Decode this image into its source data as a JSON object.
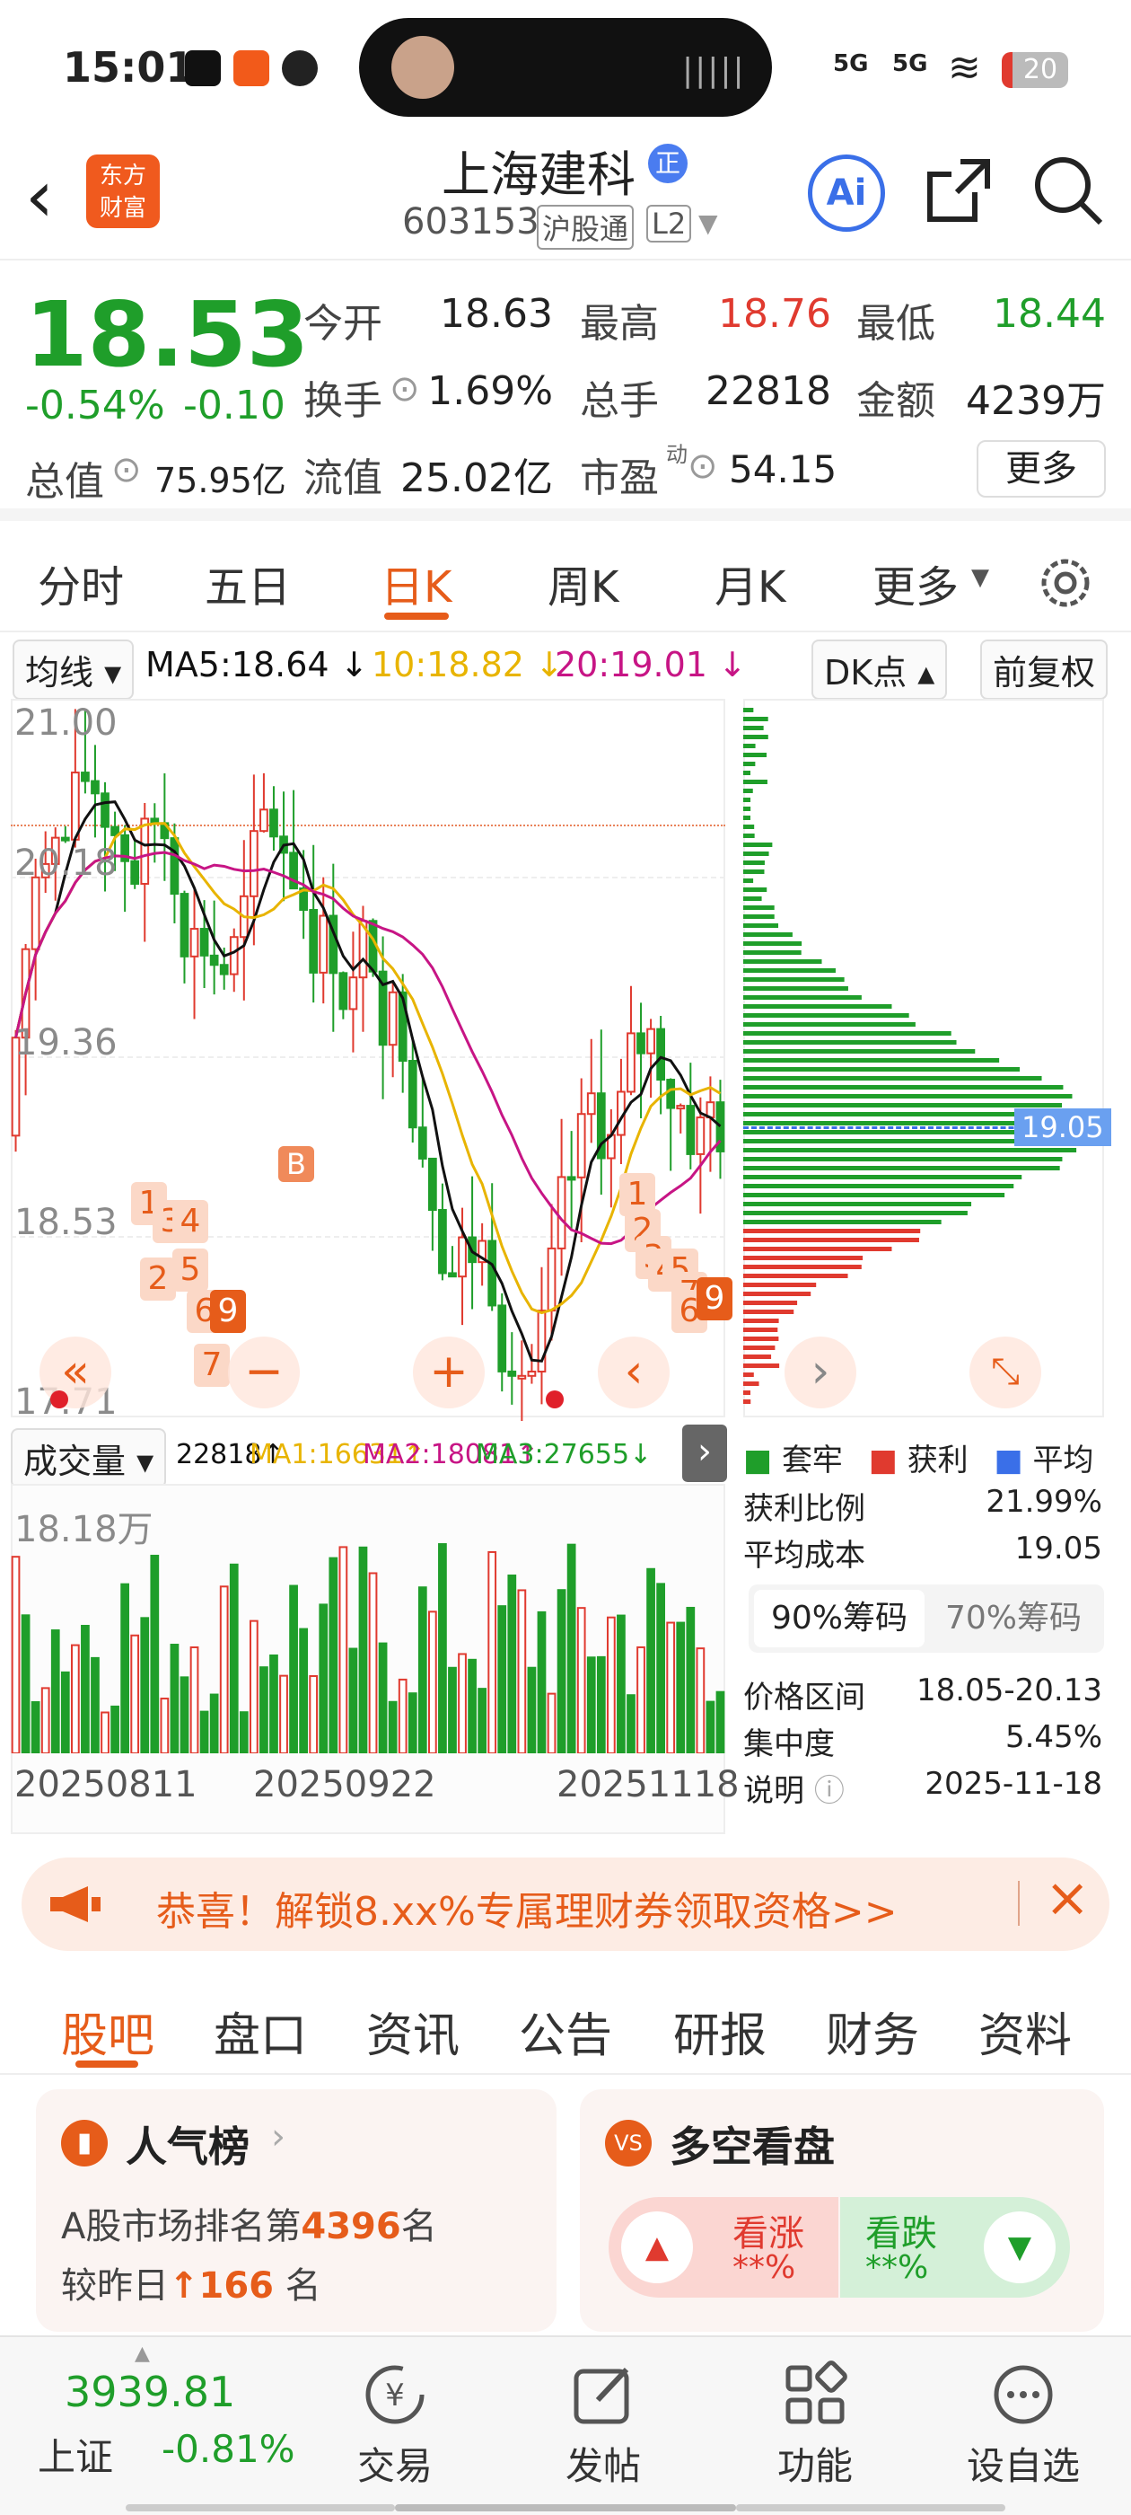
{
  "status_bar": {
    "time": "15:01",
    "signal1": "5G",
    "signal2": "5G",
    "battery": "20"
  },
  "header": {
    "title": "上海建科",
    "code": "603153",
    "market_tag": "沪股通",
    "level_tag": "L2",
    "logo_line1": "东方",
    "logo_line2": "财富",
    "badge": "正",
    "ai_label": "Ai"
  },
  "quote": {
    "price": "18.53",
    "change_pct": "-0.54%",
    "change_abs": "-0.10",
    "open_label": "今开",
    "open": "18.63",
    "high_label": "最高",
    "high": "18.76",
    "low_label": "最低",
    "low": "18.44",
    "turnover_label": "换手",
    "turnover": "1.69%",
    "volume_label": "总手",
    "volume": "22818",
    "amount_label": "金额",
    "amount": "4239万",
    "mktcap_label": "总值",
    "mktcap": "75.95亿",
    "float_label": "流值",
    "float_cap": "25.02亿",
    "pe_label": "市盈",
    "pe_sup": "动",
    "pe": "54.15",
    "more": "更多"
  },
  "chart_tabs": [
    "分时",
    "五日",
    "日K",
    "周K",
    "月K",
    "更多"
  ],
  "active_tab": "日K",
  "ma_bar": {
    "selector": "均线",
    "ma5": "MA5:18.64 ↓",
    "ma10": "10:18.82 ↓",
    "ma20": "20:19.01 ↓",
    "dk": "DK点",
    "adjust": "前复权"
  },
  "kline": {
    "y_labels": [
      "21.00",
      "20.18",
      "19.36",
      "18.53",
      "17.71"
    ],
    "marker": "B"
  },
  "volume_bar": {
    "selector": "成交量",
    "vol": "22818↑",
    "ma1": "MA1:16631↑",
    "ma2": "MA2:18081↑",
    "ma3": "MA3:27655↓",
    "max_label": "18.18万"
  },
  "dates": [
    "20250811",
    "20250922",
    "20251118"
  ],
  "chips": {
    "cost_line": "19.05",
    "legend": [
      "套牢",
      "获利",
      "平均"
    ],
    "profit_ratio_label": "获利比例",
    "profit_ratio": "21.99%",
    "avg_cost_label": "平均成本",
    "avg_cost": "19.05",
    "tab90": "90%筹码",
    "tab70": "70%筹码",
    "range_label": "价格区间",
    "range": "18.05-20.13",
    "conc_label": "集中度",
    "conc": "5.45%",
    "note_label": "说明",
    "date": "2025-11-18"
  },
  "banner": {
    "text": "恭喜！解锁8.xx%专属理财券领取资格>>"
  },
  "sub_tabs": [
    "股吧",
    "盘口",
    "资讯",
    "公告",
    "研报",
    "财务",
    "资料"
  ],
  "popularity": {
    "title": "人气榜",
    "line1_prefix": "A股市场排名第",
    "rank": "4396",
    "line1_suffix": "名",
    "line2_prefix": "较昨日",
    "delta": "166",
    "line2_suffix": "名"
  },
  "sentiment": {
    "title": "多空看盘",
    "up": "看涨",
    "up_pct": "**%",
    "down": "看跌",
    "down_pct": "**%"
  },
  "bottom_nav": {
    "index_value": "3939.81",
    "index_name": "上证",
    "index_change": "-0.81%",
    "items": [
      "交易",
      "发帖",
      "功能",
      "设自选"
    ]
  },
  "colors": {
    "up": "#e03a2f",
    "down": "#1f9e2a",
    "accent": "#e65c1a",
    "ma5": "#111111",
    "ma10": "#e8b400",
    "ma20": "#c71585"
  },
  "chart_data": {
    "type": "candlestick",
    "y_axis_ticks": [
      21.0,
      20.18,
      19.36,
      18.53,
      17.71
    ],
    "x_ticks": [
      "20250811",
      "20250922",
      "20251118"
    ],
    "moving_averages": {
      "MA5": 18.64,
      "MA10": 18.82,
      "MA20": 19.01
    },
    "last_close": 18.53,
    "chip_distribution": {
      "avg_cost": 19.05,
      "profit_ratio": 0.2199,
      "range": [
        18.05,
        20.13
      ],
      "concentration": 0.0545
    }
  }
}
